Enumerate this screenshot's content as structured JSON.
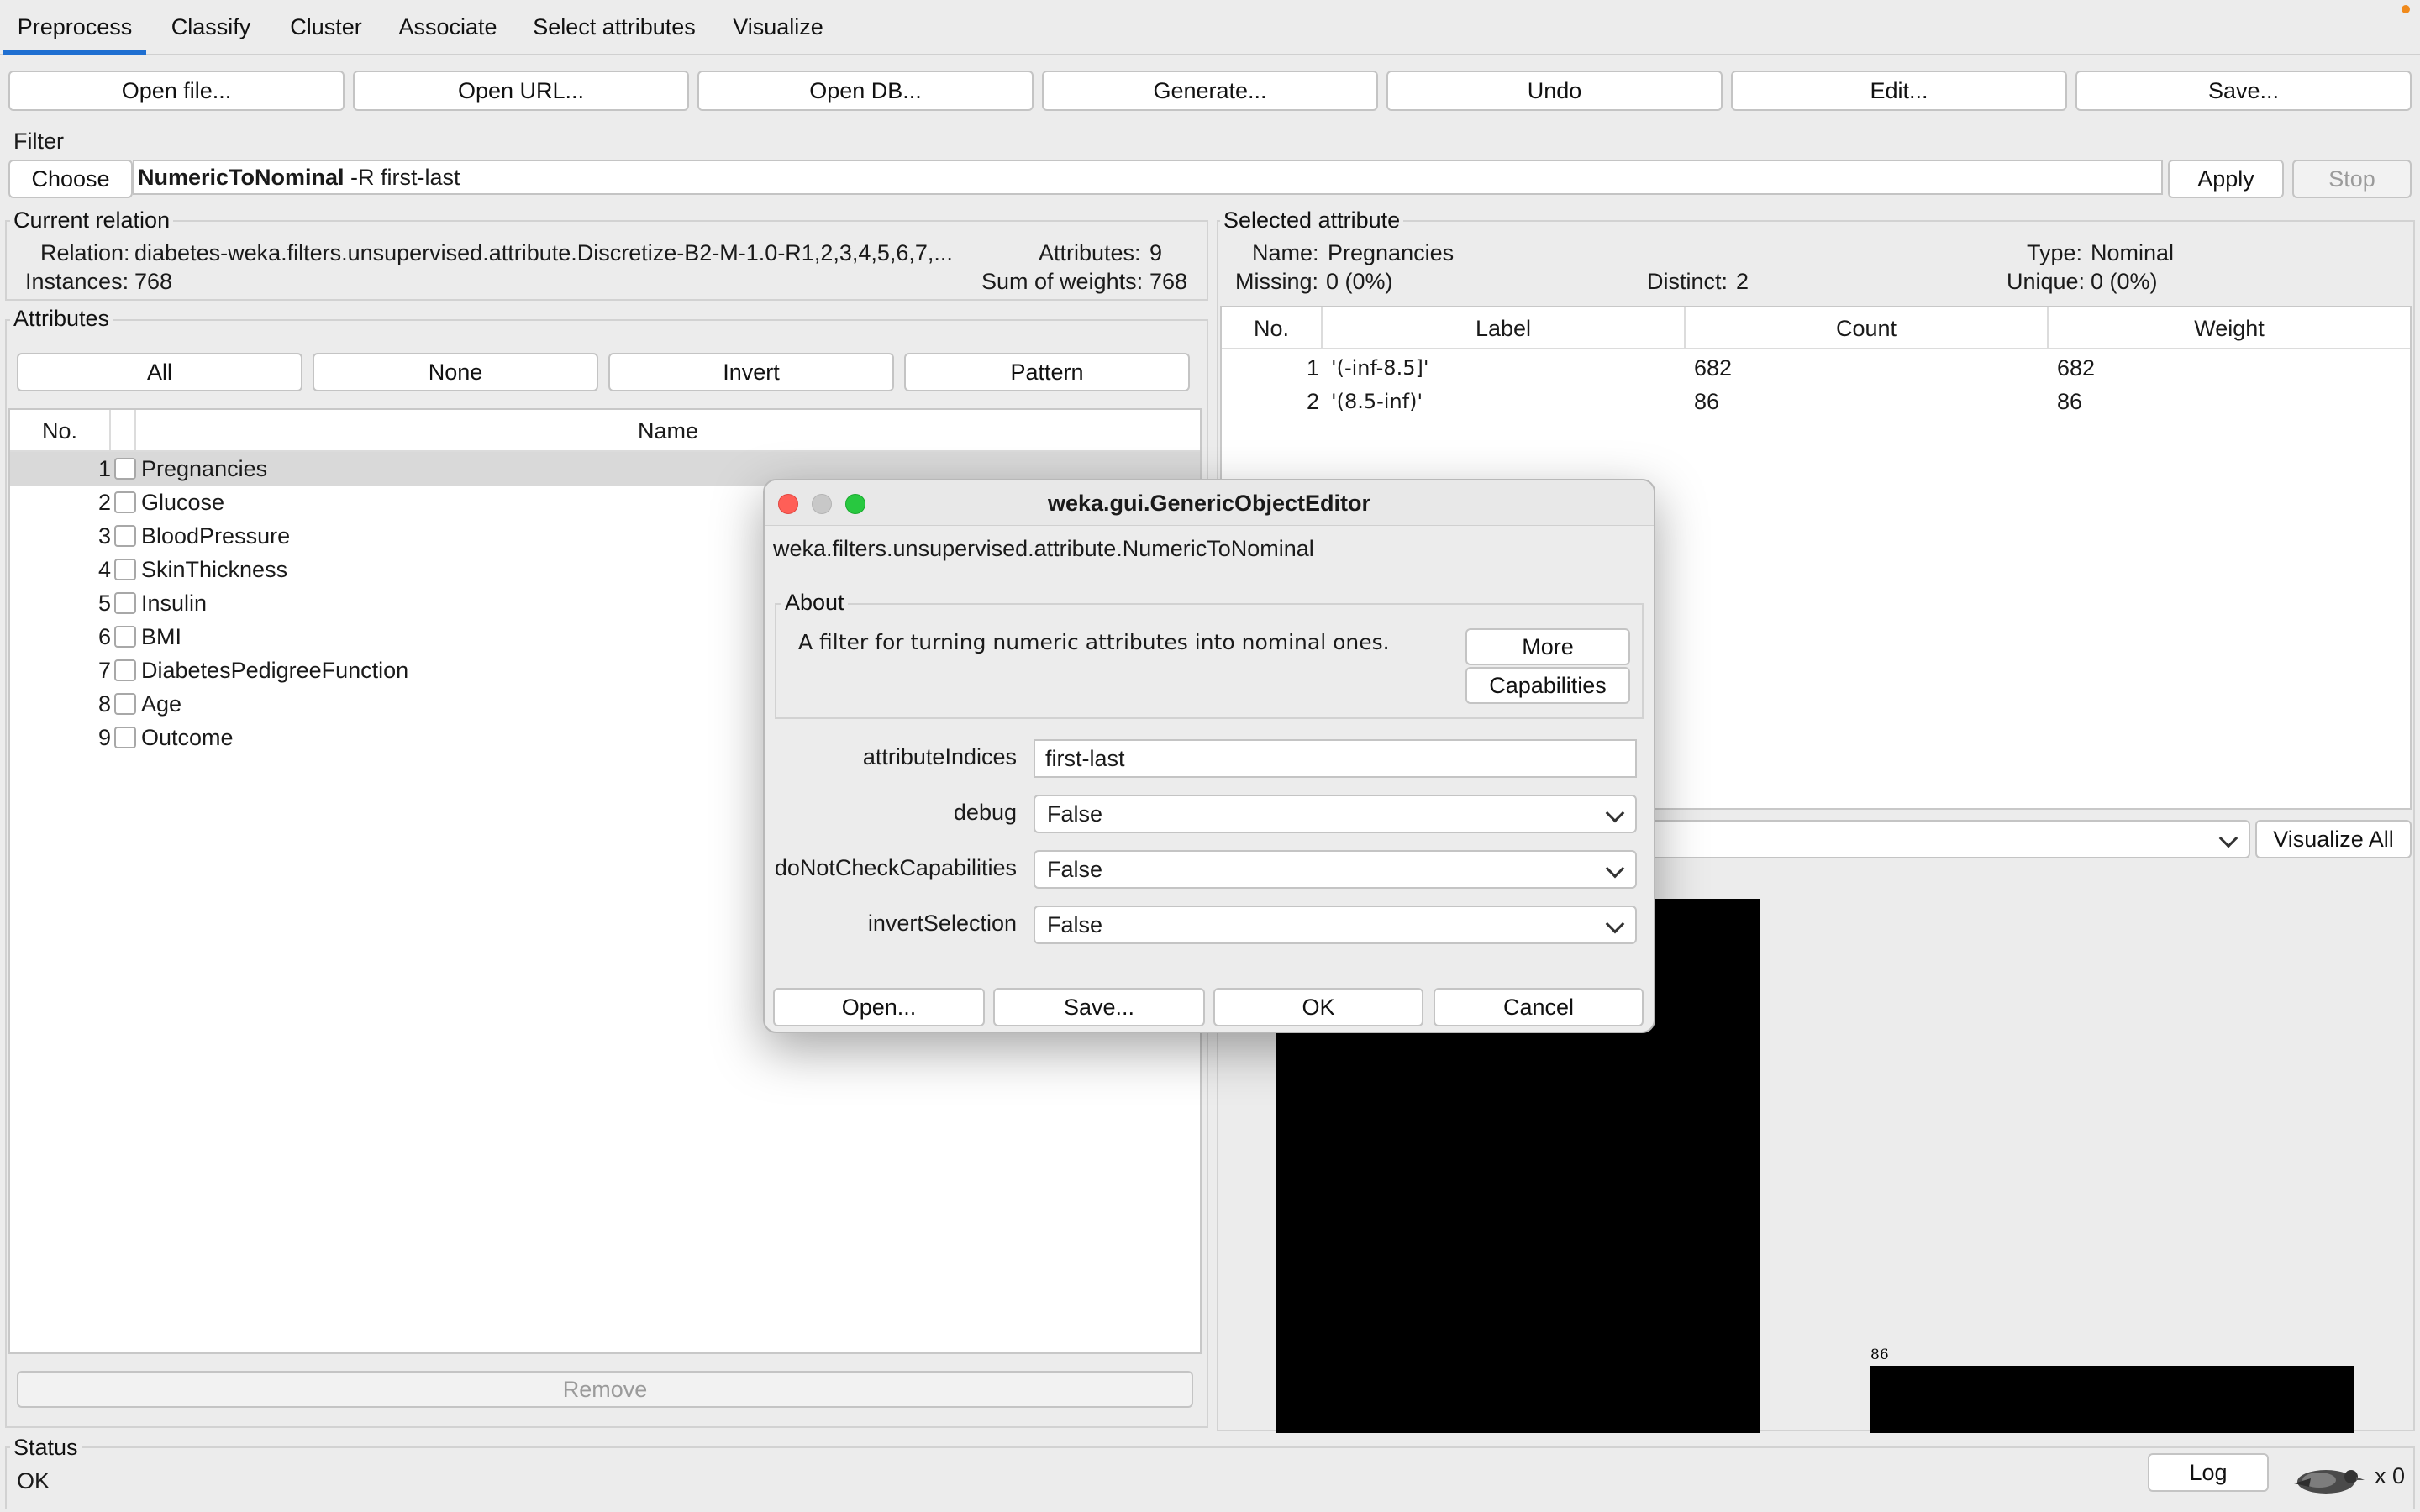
{
  "tabs": [
    "Preprocess",
    "Classify",
    "Cluster",
    "Associate",
    "Select attributes",
    "Visualize"
  ],
  "toolbar": [
    "Open file...",
    "Open URL...",
    "Open DB...",
    "Generate...",
    "Undo",
    "Edit...",
    "Save..."
  ],
  "filter": {
    "legend": "Filter",
    "choose_label": "Choose",
    "name": "NumericToNominal",
    "options": " -R first-last",
    "apply_label": "Apply",
    "stop_label": "Stop"
  },
  "current_relation": {
    "legend": "Current relation",
    "relation_label": "Relation:",
    "relation_value": "diabetes-weka.filters.unsupervised.attribute.Discretize-B2-M-1.0-R1,2,3,4,5,6,7,...",
    "instances_label": "Instances:",
    "instances_value": "768",
    "attributes_label": "Attributes:",
    "attributes_value": "9",
    "sum_label": "Sum of weights:",
    "sum_value": "768"
  },
  "attributes": {
    "legend": "Attributes",
    "buttons": [
      "All",
      "None",
      "Invert",
      "Pattern"
    ],
    "col_no": "No.",
    "col_name": "Name",
    "rows": [
      {
        "no": "1",
        "name": "Pregnancies"
      },
      {
        "no": "2",
        "name": "Glucose"
      },
      {
        "no": "3",
        "name": "BloodPressure"
      },
      {
        "no": "4",
        "name": "SkinThickness"
      },
      {
        "no": "5",
        "name": "Insulin"
      },
      {
        "no": "6",
        "name": "BMI"
      },
      {
        "no": "7",
        "name": "DiabetesPedigreeFunction"
      },
      {
        "no": "8",
        "name": "Age"
      },
      {
        "no": "9",
        "name": "Outcome"
      }
    ],
    "remove_label": "Remove"
  },
  "selected_attribute": {
    "legend": "Selected attribute",
    "name_label": "Name:",
    "name_value": "Pregnancies",
    "type_label": "Type:",
    "type_value": "Nominal",
    "missing_label": "Missing:",
    "missing_value": "0 (0%)",
    "distinct_label": "Distinct:",
    "distinct_value": "2",
    "unique_label": "Unique:",
    "unique_value": "0 (0%)",
    "columns": [
      "No.",
      "Label",
      "Count",
      "Weight"
    ],
    "rows": [
      {
        "no": "1",
        "label": "'(-inf-8.5]'",
        "count": "682",
        "weight": "682"
      },
      {
        "no": "2",
        "label": "'(8.5-inf)'",
        "count": "86",
        "weight": "86"
      }
    ],
    "visualize_all_label": "Visualize All"
  },
  "chart_data": {
    "type": "bar",
    "categories": [
      "'(-inf-8.5]'",
      "'(8.5-inf)'"
    ],
    "values": [
      682,
      86
    ],
    "ylim": [
      0,
      682
    ],
    "data_labels": [
      "",
      "86"
    ],
    "bar_color": "#000000"
  },
  "status": {
    "legend": "Status",
    "text": "OK",
    "log_label": "Log",
    "count_label": "x 0"
  },
  "dialog": {
    "title": "weka.gui.GenericObjectEditor",
    "class_name": "weka.filters.unsupervised.attribute.NumericToNominal",
    "about_legend": "About",
    "about_text": "A filter for turning numeric attributes into nominal ones.",
    "more_label": "More",
    "capabilities_label": "Capabilities",
    "fields": [
      {
        "label": "attributeIndices",
        "value": "first-last",
        "kind": "text"
      },
      {
        "label": "debug",
        "value": "False",
        "kind": "select"
      },
      {
        "label": "doNotCheckCapabilities",
        "value": "False",
        "kind": "select"
      },
      {
        "label": "invertSelection",
        "value": "False",
        "kind": "select"
      }
    ],
    "footer_buttons": [
      "Open...",
      "Save...",
      "OK",
      "Cancel"
    ]
  },
  "colors": {
    "accent": "#1f6fd1",
    "close": "#ff5f57",
    "minimize": "#c8c8c8",
    "zoom": "#28c840",
    "selected_row": "#d9d9d9"
  }
}
